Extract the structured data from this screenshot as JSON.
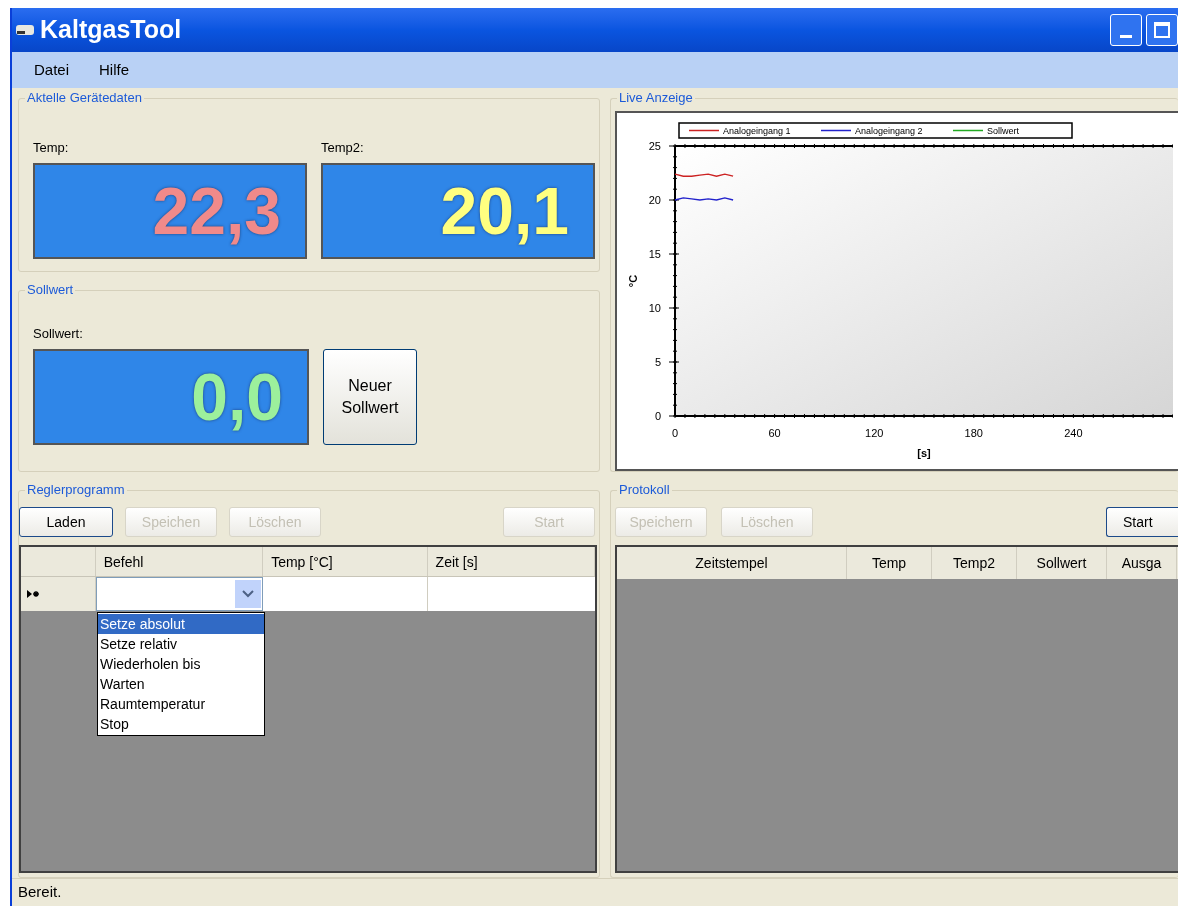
{
  "window": {
    "title": "KaltgasTool"
  },
  "menu": [
    "Datei",
    "Hilfe"
  ],
  "device_group": {
    "title": "Aktelle Gerätedaten",
    "displays": [
      {
        "label": "Temp:",
        "value": "22,3",
        "color": "#f08a8a"
      },
      {
        "label": "Temp2:",
        "value": "20,1",
        "color": "#ffff80"
      }
    ]
  },
  "setpoint_group": {
    "title": "Sollwert",
    "display": {
      "label": "Sollwert:",
      "value": "0,0",
      "color": "#9cf09c"
    },
    "button": "Neuer Sollwert"
  },
  "live_group": {
    "title": "Live Anzeige",
    "chart_data": {
      "type": "line",
      "xlabel": "[s]",
      "ylabel": "°C",
      "x": [
        0,
        5,
        10,
        15,
        20,
        25,
        30,
        35
      ],
      "series": [
        {
          "name": "Analogeingang 1",
          "color": "#cc2222",
          "values": [
            22.4,
            22.2,
            22.2,
            22.3,
            22.4,
            22.2,
            22.4,
            22.2
          ]
        },
        {
          "name": "Analogeingang 2",
          "color": "#2222cc",
          "values": [
            20.0,
            20.2,
            20.1,
            20.0,
            20.1,
            20.0,
            20.2,
            20.0
          ]
        },
        {
          "name": "Sollwert",
          "color": "#22aa22",
          "values": [
            null,
            null,
            null,
            null,
            null,
            null,
            null,
            null
          ]
        }
      ],
      "legend": "top",
      "xlim": [
        0,
        300
      ],
      "ylim": [
        0,
        25
      ],
      "xticks": [
        0,
        60,
        120,
        180,
        240
      ],
      "yticks": [
        0,
        5,
        10,
        15,
        20,
        25
      ]
    }
  },
  "program_group": {
    "title": "Reglerprogramm",
    "buttons": [
      {
        "label": "Laden",
        "disabled": false
      },
      {
        "label": "Speichen",
        "disabled": true
      },
      {
        "label": "Löschen",
        "disabled": true
      },
      {
        "label": "Start",
        "disabled": true
      }
    ],
    "columns": [
      "Befehl",
      "Temp [°C]",
      "Zeit [s]"
    ],
    "dropdown_options": [
      {
        "label": "Setze absolut",
        "selected": true
      },
      {
        "label": "Setze relativ",
        "selected": false
      },
      {
        "label": "Wiederholen bis",
        "selected": false
      },
      {
        "label": "Warten",
        "selected": false
      },
      {
        "label": "Raumtemperatur",
        "selected": false
      },
      {
        "label": "Stop",
        "selected": false
      }
    ]
  },
  "protocol_group": {
    "title": "Protokoll",
    "buttons": [
      {
        "label": "Speichern",
        "disabled": true
      },
      {
        "label": "Löschen",
        "disabled": true
      },
      {
        "label": "Start",
        "disabled": false
      }
    ],
    "columns": [
      "Zeitstempel",
      "Temp",
      "Temp2",
      "Sollwert",
      "Ausga"
    ]
  },
  "status_bar": "Bereit."
}
